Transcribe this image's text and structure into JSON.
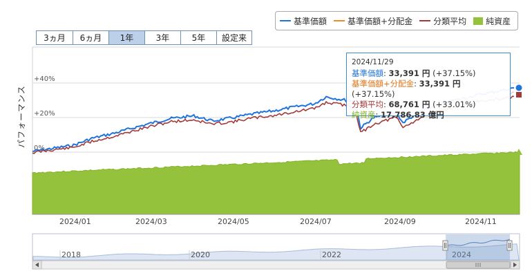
{
  "legend": {
    "items": [
      {
        "label": "基準価額",
        "color": "#1f74dd",
        "type": "line"
      },
      {
        "label": "基準価額+分配金",
        "color": "#f28a1f",
        "type": "line"
      },
      {
        "label": "分類平均",
        "color": "#a33a3a",
        "type": "line"
      },
      {
        "label": "純資産",
        "color": "#95c23d",
        "type": "area"
      }
    ]
  },
  "range_buttons": [
    {
      "label": "3ヵ月",
      "selected": false
    },
    {
      "label": "6ヵ月",
      "selected": false
    },
    {
      "label": "1年",
      "selected": true
    },
    {
      "label": "3年",
      "selected": false
    },
    {
      "label": "5年",
      "selected": false
    },
    {
      "label": "設定来",
      "selected": false
    }
  ],
  "yaxis_label": "パフォーマンス",
  "tooltip": {
    "date": "2024/11/29",
    "rows": [
      {
        "label": "基準価額",
        "value": "33,391 円",
        "extra": "(+37.15%)",
        "color": "#1f74dd"
      },
      {
        "label": "基準価額+分配金",
        "value": "33,391 円",
        "extra": "(+37.15%)",
        "color": "#e0761a"
      },
      {
        "label": "分類平均",
        "value": "68,761 円",
        "extra": "(+33.01%)",
        "color": "#a33a3a"
      },
      {
        "label": "純資産",
        "value": "17,786.83 億円",
        "extra": "",
        "color": "#84b224"
      }
    ]
  },
  "chart_data": {
    "type": "line",
    "x_ticks": [
      "2024/01",
      "2024/03",
      "2024/05",
      "2024/07",
      "2024/09",
      "2024/11"
    ],
    "y_ticks": [
      "0%",
      "+20%",
      "+40%"
    ],
    "ylim_percent": [
      -8,
      48
    ],
    "series": [
      {
        "name": "基準価額",
        "color": "#1f74dd",
        "x": [
          "2023/12/01",
          "2023/12/15",
          "2024/01/01",
          "2024/01/15",
          "2024/02/01",
          "2024/02/15",
          "2024/03/01",
          "2024/03/15",
          "2024/04/01",
          "2024/04/15",
          "2024/05/01",
          "2024/05/15",
          "2024/06/01",
          "2024/06/15",
          "2024/07/01",
          "2024/07/10",
          "2024/07/25",
          "2024/08/01",
          "2024/08/05",
          "2024/08/15",
          "2024/09/01",
          "2024/09/06",
          "2024/09/20",
          "2024/10/01",
          "2024/10/15",
          "2024/11/01",
          "2024/11/15",
          "2024/11/29"
        ],
        "values": [
          0.5,
          2,
          4,
          8,
          11,
          14,
          17,
          19.5,
          21,
          18,
          20,
          22,
          24,
          26,
          28,
          32,
          30,
          29,
          14,
          20,
          23,
          17,
          24,
          27,
          30,
          33,
          35,
          37.15
        ]
      },
      {
        "name": "基準価額+分配金",
        "color": "#f28a1f",
        "x": [
          "2023/12/01",
          "2024/11/29"
        ],
        "values": [
          0.5,
          37.15
        ]
      },
      {
        "name": "分類平均",
        "color": "#a33a3a",
        "x": [
          "2023/12/01",
          "2023/12/15",
          "2024/01/01",
          "2024/01/15",
          "2024/02/01",
          "2024/02/15",
          "2024/03/01",
          "2024/03/15",
          "2024/04/01",
          "2024/04/15",
          "2024/05/01",
          "2024/05/15",
          "2024/06/01",
          "2024/06/15",
          "2024/07/01",
          "2024/07/10",
          "2024/07/25",
          "2024/08/01",
          "2024/08/05",
          "2024/08/15",
          "2024/09/01",
          "2024/09/06",
          "2024/09/20",
          "2024/10/01",
          "2024/10/15",
          "2024/11/01",
          "2024/11/15",
          "2024/11/29"
        ],
        "values": [
          0.5,
          2,
          3.5,
          7,
          10,
          13,
          16,
          18.5,
          19.5,
          17,
          18.5,
          20.5,
          22,
          24,
          26,
          29.5,
          28,
          26,
          12,
          17,
          21,
          15,
          21,
          24,
          27,
          30,
          31,
          33.01
        ]
      },
      {
        "name": "純資産",
        "color": "#95c23d",
        "type": "area",
        "x": [
          "2023/12/01",
          "2024/11/29"
        ],
        "values": [
          null,
          17786.83
        ]
      }
    ]
  },
  "navigator": {
    "year_labels": [
      "2018",
      "2020",
      "2022",
      "2024"
    ]
  }
}
